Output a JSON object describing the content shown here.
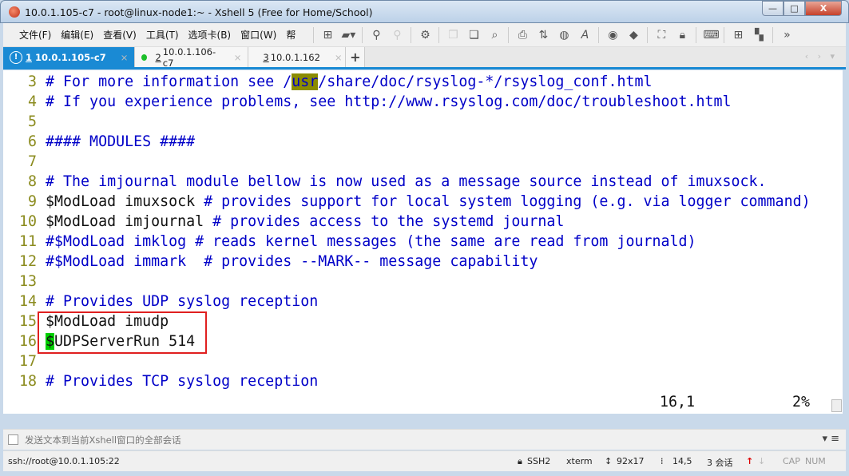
{
  "window": {
    "title": "10.0.1.105-c7 - root@linux-node1:~ - Xshell 5 (Free for Home/School)",
    "minimize": "—",
    "maximize": "□",
    "close": "X"
  },
  "menu": [
    "文件(F)",
    "编辑(E)",
    "查看(V)",
    "工具(T)",
    "选项卡(B)",
    "窗口(W)",
    "帮"
  ],
  "toolbar_icons": [
    "new-session-icon",
    "open-folder-icon",
    "connect-icon",
    "disconnect-icon",
    "settings-icon",
    "copy-icon",
    "paste-icon",
    "find-icon",
    "print-icon",
    "transfer-icon",
    "globe-icon",
    "font-icon",
    "xftp-icon",
    "xmanager-icon",
    "fullscreen-icon",
    "lock-icon",
    "keyboard-icon",
    "add-tab-icon",
    "layout-icon",
    "more-icon"
  ],
  "tabs": [
    {
      "num": "1",
      "label": "10.0.1.105-c7",
      "status": "warning"
    },
    {
      "num": "2",
      "label": "10.0.1.106-c7",
      "status": "connected"
    },
    {
      "num": "3",
      "label": "10.0.1.162",
      "status": "connected"
    }
  ],
  "add_tab": "+",
  "terminal": {
    "lines": [
      {
        "n": " 3",
        "s": [
          {
            "t": "# For more information see /",
            "c": "c"
          },
          {
            "t": "usr",
            "c": "hl"
          },
          {
            "t": "/share/doc/rsyslog-*/rsyslog_conf.html",
            "c": "c"
          }
        ]
      },
      {
        "n": " 4",
        "s": [
          {
            "t": "# If you experience problems, see http://www.rsyslog.com/doc/troubleshoot.html",
            "c": "c"
          }
        ]
      },
      {
        "n": " 5",
        "s": []
      },
      {
        "n": " 6",
        "s": [
          {
            "t": "#### MODULES ####",
            "c": "c"
          }
        ]
      },
      {
        "n": " 7",
        "s": []
      },
      {
        "n": " 8",
        "s": [
          {
            "t": "# The imjournal module bellow is now used as a message source instead of imuxsock.",
            "c": "c"
          }
        ]
      },
      {
        "n": " 9",
        "s": [
          {
            "t": "$ModLoad imuxsock ",
            "c": "k"
          },
          {
            "t": "# provides support for local system logging (e.g. via logger command)",
            "c": "c"
          }
        ]
      },
      {
        "n": "10",
        "s": [
          {
            "t": "$ModLoad imjournal ",
            "c": "k"
          },
          {
            "t": "# provides access to the systemd journal",
            "c": "c"
          }
        ]
      },
      {
        "n": "11",
        "s": [
          {
            "t": "#$ModLoad imklog # reads kernel messages (the same are read from journald)",
            "c": "c"
          }
        ]
      },
      {
        "n": "12",
        "s": [
          {
            "t": "#$ModLoad immark  # provides --MARK-- message capability",
            "c": "c"
          }
        ]
      },
      {
        "n": "13",
        "s": []
      },
      {
        "n": "14",
        "s": [
          {
            "t": "# Provides UDP syslog reception",
            "c": "c"
          }
        ]
      },
      {
        "n": "15",
        "s": [
          {
            "t": "$ModLoad imudp",
            "c": "k"
          }
        ]
      },
      {
        "n": "16",
        "s": [
          {
            "t": "$",
            "c": "cur"
          },
          {
            "t": "UDPServerRun 514",
            "c": "k"
          }
        ]
      },
      {
        "n": "17",
        "s": []
      },
      {
        "n": "18",
        "s": [
          {
            "t": "# Provides TCP syslog reception",
            "c": "c"
          }
        ]
      }
    ],
    "cursor_pos": "16,1",
    "percent": "2%"
  },
  "input_bar": {
    "placeholder": "发送文本到当前Xshell窗口的全部会话"
  },
  "status": {
    "connection": "ssh://root@10.0.1.105:22",
    "protocol": "SSH2",
    "terminal": "xterm",
    "size": "92x17",
    "cursor": "14,5",
    "sessions": "3 会话",
    "caps": "CAP",
    "num": "NUM"
  }
}
